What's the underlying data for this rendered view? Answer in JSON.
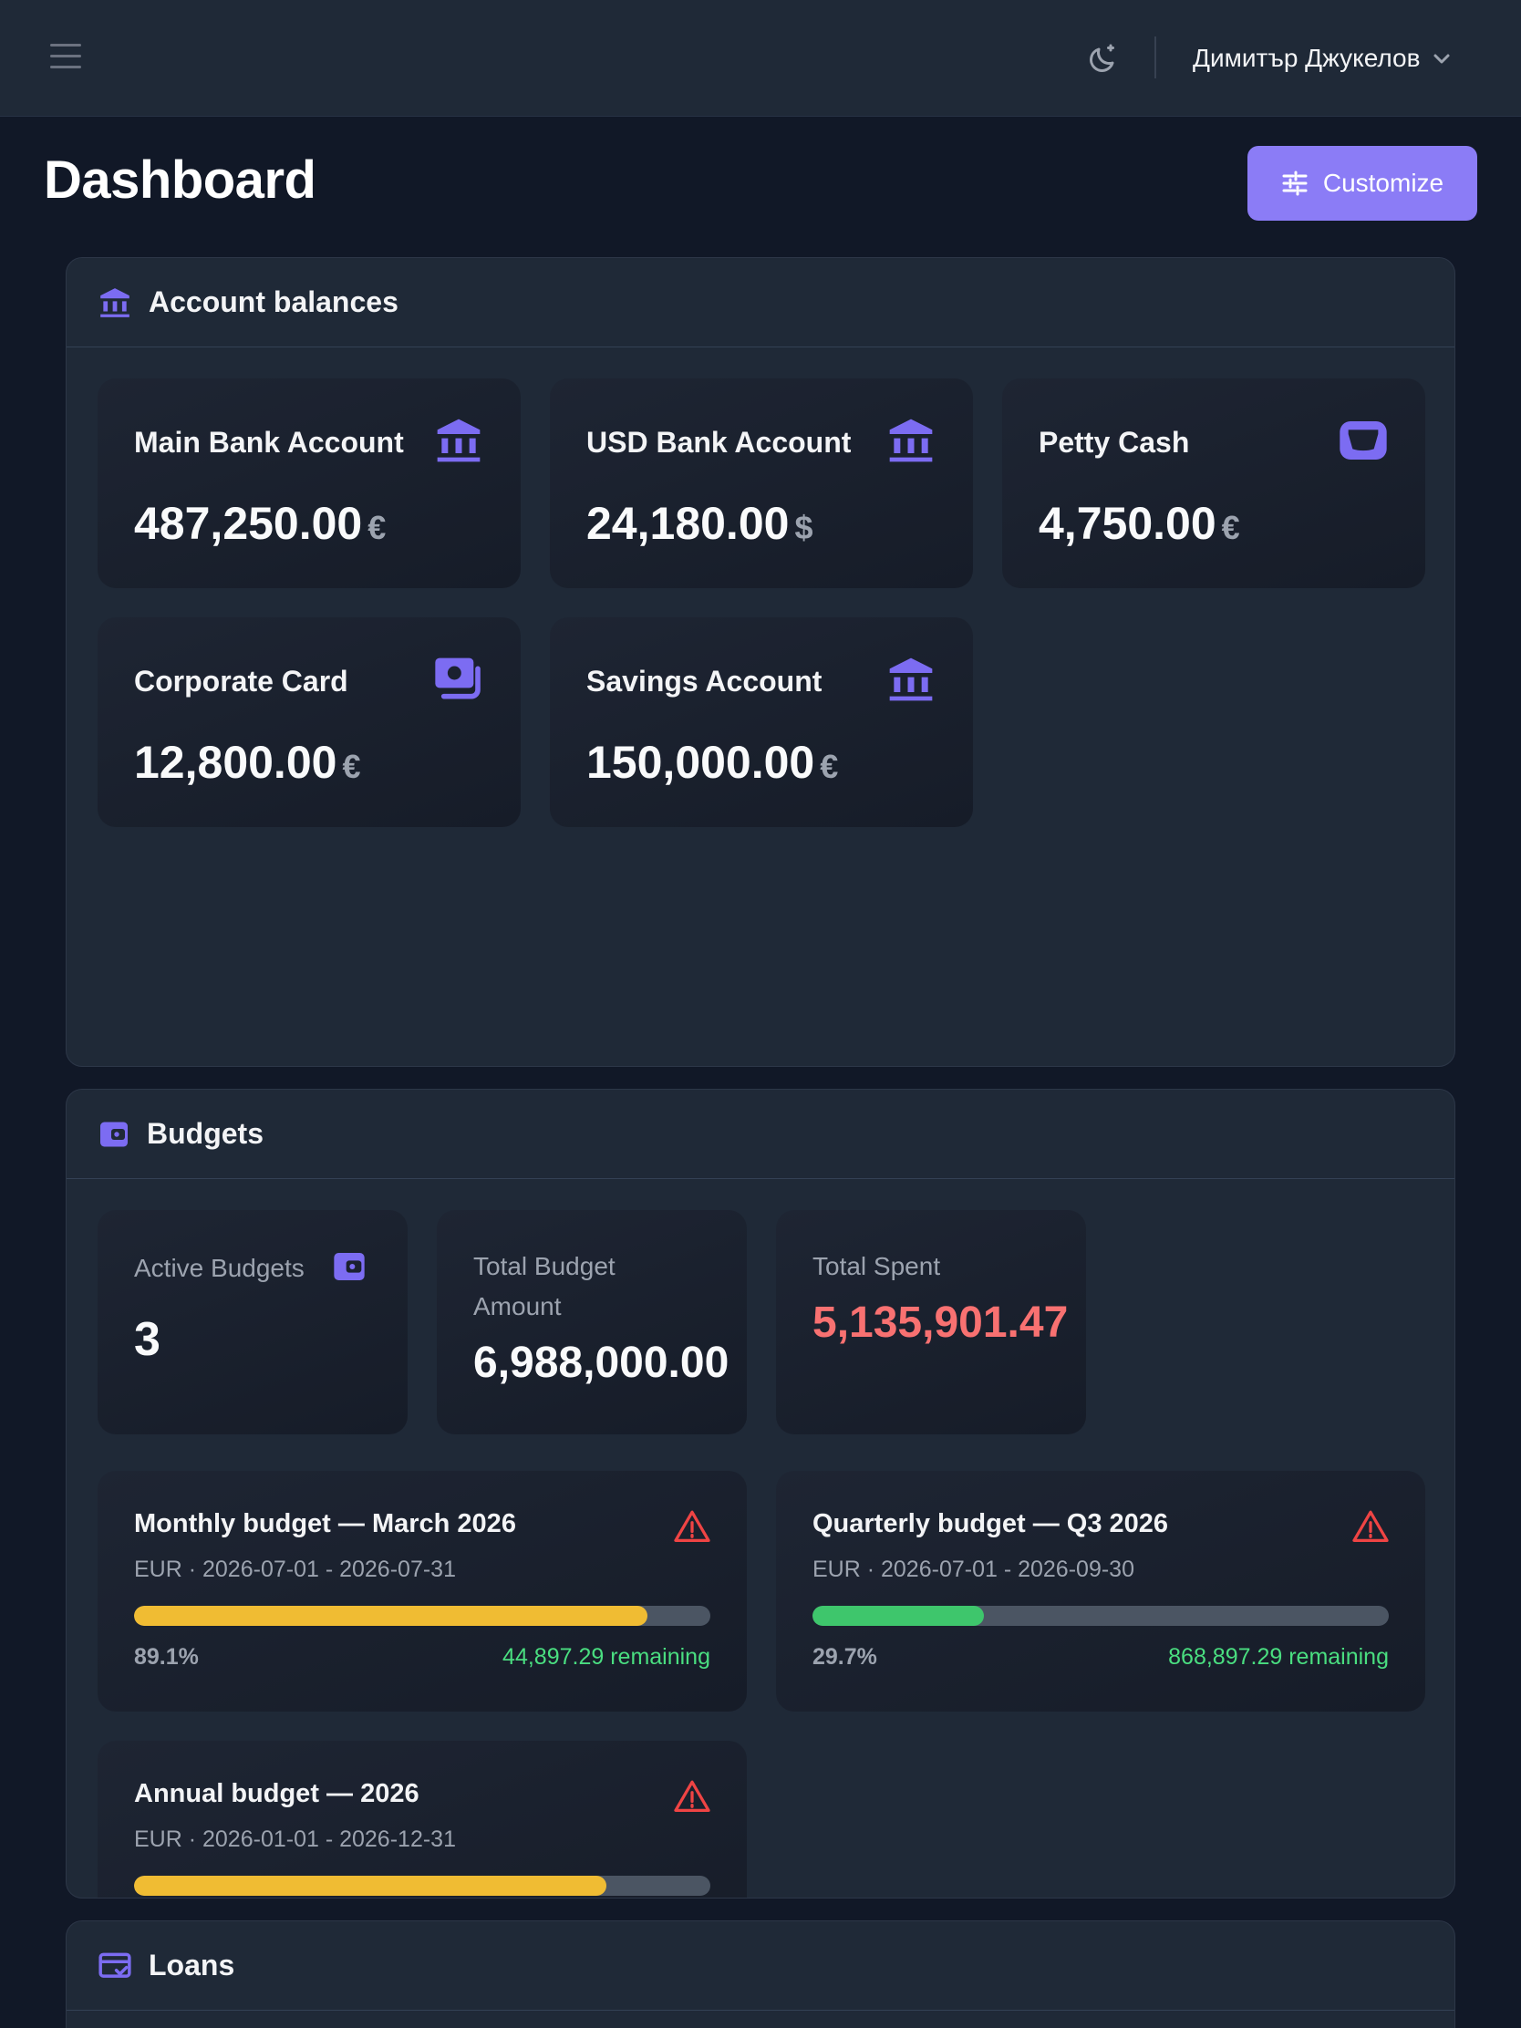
{
  "header": {
    "user_name": "Димитър Джукелов"
  },
  "page": {
    "title": "Dashboard",
    "customize_label": "Customize"
  },
  "account_balances": {
    "title": "Account balances",
    "accounts": [
      {
        "name": "Main Bank Account",
        "balance": "487,250.00",
        "currency": "€",
        "icon": "bank-icon"
      },
      {
        "name": "USD Bank Account",
        "balance": "24,180.00",
        "currency": "$",
        "icon": "bank-icon"
      },
      {
        "name": "Petty Cash",
        "balance": "4,750.00",
        "currency": "€",
        "icon": "wallet-icon"
      },
      {
        "name": "Corporate Card",
        "balance": "12,800.00",
        "currency": "€",
        "icon": "cash-icon"
      },
      {
        "name": "Savings Account",
        "balance": "150,000.00",
        "currency": "€",
        "icon": "bank-icon"
      }
    ]
  },
  "budgets": {
    "title": "Budgets",
    "stats": {
      "active_label": "Active Budgets",
      "active_value": "3",
      "total_amount_label": "Total Budget Amount",
      "total_amount_value": "6,988,000.00",
      "total_spent_label": "Total Spent",
      "total_spent_value": "5,135,901.47"
    },
    "items": [
      {
        "name": "Monthly budget — March 2026",
        "period": "EUR · 2026-07-01 - 2026-07-31",
        "percent_label": "89.1%",
        "progress": 0.891,
        "remaining": "44,897.29 remaining",
        "bar_color": "#f0bc33"
      },
      {
        "name": "Quarterly budget — Q3 2026",
        "period": "EUR · 2026-07-01 - 2026-09-30",
        "percent_label": "29.7%",
        "progress": 0.297,
        "remaining": "868,897.29 remaining",
        "bar_color": "#3ec66c"
      },
      {
        "name": "Annual budget — 2026",
        "period": "EUR · 2026-01-01 - 2026-12-31",
        "progress": 0.82,
        "bar_color": "#f0bc33"
      }
    ]
  },
  "loans": {
    "title": "Loans"
  },
  "colors": {
    "accent": "#8b7cf6",
    "icon_purple": "#7c6cf2",
    "spent_red": "#f87171",
    "alert_red": "#ef4444",
    "remaining_green": "#4ade80"
  }
}
